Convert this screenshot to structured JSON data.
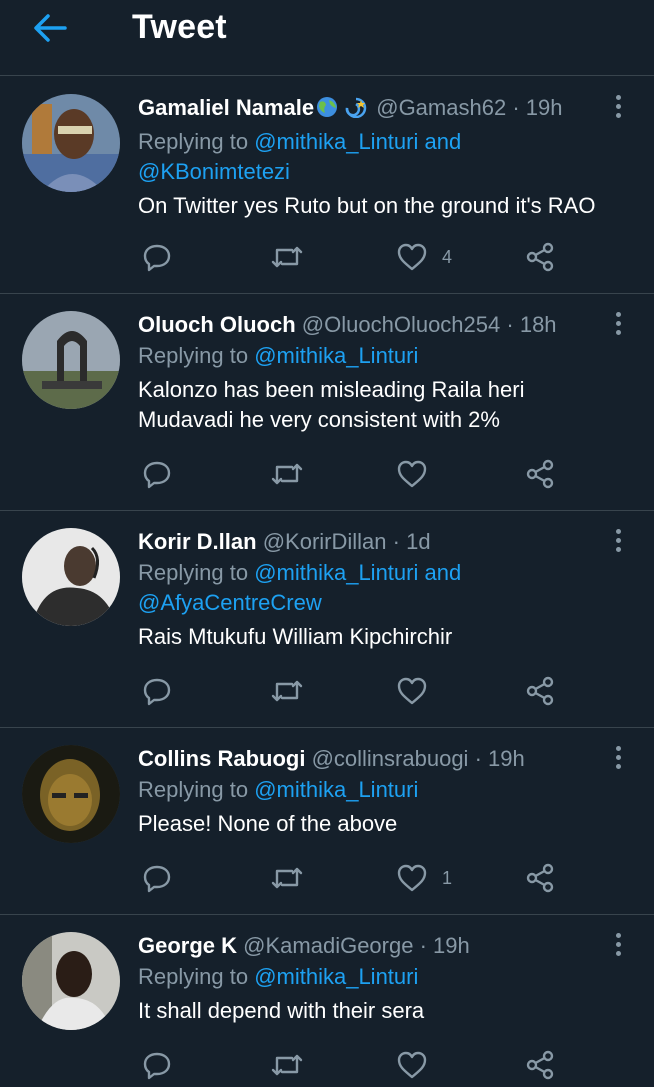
{
  "header": {
    "title": "Tweet",
    "back_icon": "arrow-left-icon",
    "accent": "#1da1f2"
  },
  "tweets": [
    {
      "name": "Gamaliel Namale",
      "emoji": [
        "globe-emoji",
        "dizzy-emoji"
      ],
      "handle": "@Gamash62",
      "dot": "·",
      "time": "19h",
      "replying_prefix": "Replying to ",
      "replying_links": "@mithika_Linturi and",
      "replying_links2": "@KBonimtetezi",
      "text": "On Twitter yes Ruto but on the ground it's  RAO",
      "likes": "4"
    },
    {
      "name": "Oluoch Oluoch",
      "handle": "@OluochOluoch254",
      "dot": "·",
      "time": "18h",
      "replying_prefix": "Replying to ",
      "replying_links": "@mithika_Linturi",
      "text1": "Kalonzo has been misleading Raila heri",
      "text2": "Mudavadi he very consistent with 2%",
      "likes": ""
    },
    {
      "name": "Korir D.llan",
      "handle": "@KorirDillan",
      "dot": "·",
      "time": "1d",
      "replying_prefix": "Replying to ",
      "replying_links": "@mithika_Linturi and",
      "replying_links2": "@AfyaCentreCrew",
      "text": "Rais Mtukufu William Kipchirchir",
      "likes": ""
    },
    {
      "name": "Collins Rabuogi",
      "handle": "@collinsrabuogi",
      "dot": "·",
      "time": "19h",
      "replying_prefix": "Replying to ",
      "replying_links": "@mithika_Linturi",
      "text": "Please! None of the above",
      "likes": "1"
    },
    {
      "name": "George K",
      "handle": "@KamadiGeorge",
      "dot": "·",
      "time": "19h",
      "replying_prefix": "Replying to ",
      "replying_links": "@mithika_Linturi",
      "text": "It shall depend with their sera",
      "likes": ""
    }
  ]
}
